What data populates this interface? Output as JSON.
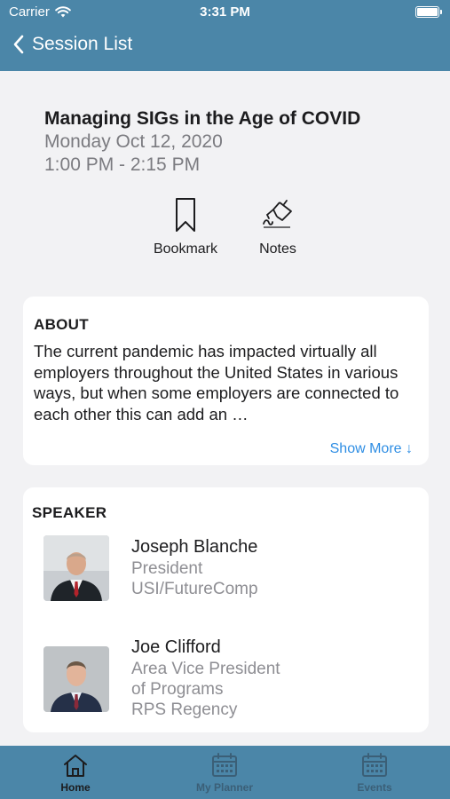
{
  "status_bar": {
    "carrier": "Carrier",
    "time": "3:31 PM"
  },
  "nav": {
    "back_label": "Session List"
  },
  "session": {
    "title": "Managing SIGs in the Age of COVID",
    "date": "Monday Oct 12, 2020",
    "time": "1:00 PM - 2:15 PM"
  },
  "actions": {
    "bookmark_label": "Bookmark",
    "notes_label": "Notes"
  },
  "about": {
    "heading": "ABOUT",
    "text": "The current pandemic has impacted virtually all employers throughout the United States in various ways, but when some employers are connected to each other this can add an …",
    "show_more": "Show More ↓"
  },
  "speakers": {
    "heading": "SPEAKER",
    "items": [
      {
        "name": "Joseph Blanche",
        "title_lines": [
          "President",
          "USI/FutureComp"
        ]
      },
      {
        "name": "Joe Clifford",
        "title_lines": [
          "Area Vice President",
          "of Programs",
          "RPS Regency"
        ]
      }
    ]
  },
  "tabs": [
    {
      "label": "Home",
      "icon": "home-icon",
      "active": true
    },
    {
      "label": "My Planner",
      "icon": "calendar-icon",
      "active": false
    },
    {
      "label": "Events",
      "icon": "calendar-icon",
      "active": false
    }
  ],
  "colors": {
    "bar": "#4b86a8",
    "link": "#2f8ee4",
    "background": "#f2f2f4"
  }
}
